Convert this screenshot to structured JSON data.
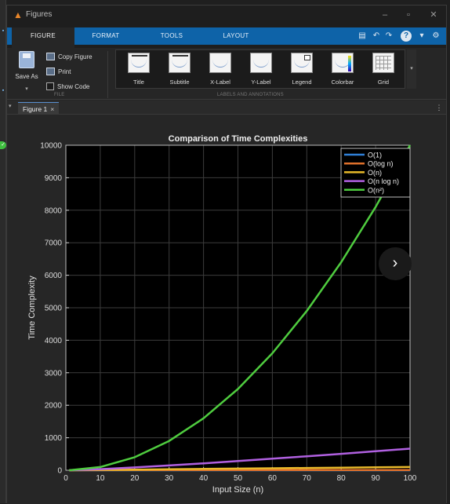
{
  "window": {
    "title": "Figures"
  },
  "ribbon_tabs": [
    {
      "label": "FIGURE",
      "active": true
    },
    {
      "label": "FORMAT",
      "active": false
    },
    {
      "label": "TOOLS",
      "active": false
    },
    {
      "label": "LAYOUT",
      "active": false
    }
  ],
  "file_section": {
    "label": "FILE",
    "save_as": "Save As",
    "copy_figure": "Copy Figure",
    "print": "Print",
    "show_code": "Show Code"
  },
  "labels_section": {
    "label": "LABELS AND ANNOTATIONS",
    "items": [
      "Title",
      "Subtitle",
      "X-Label",
      "Y-Label",
      "Legend",
      "Colorbar",
      "Grid"
    ]
  },
  "doc_tab": {
    "label": "Figure 1",
    "close": "×"
  },
  "icons": {
    "app": "matlab-icon",
    "minimize": "minimize-icon",
    "maximize": "maximize-icon",
    "close": "close-icon",
    "next": "chevron-right-icon",
    "menu": "more-vertical-icon",
    "help": "help-icon"
  },
  "chart_data": {
    "type": "line",
    "title": "Comparison of Time Complexities",
    "xlabel": "Input Size (n)",
    "ylabel": "Time Complexity",
    "xlim": [
      0,
      100
    ],
    "ylim": [
      0,
      10000
    ],
    "xticks": [
      0,
      10,
      20,
      30,
      40,
      50,
      60,
      70,
      80,
      90,
      100
    ],
    "yticks": [
      0,
      1000,
      2000,
      3000,
      4000,
      5000,
      6000,
      7000,
      8000,
      9000,
      10000
    ],
    "grid": true,
    "legend_position": "top-right",
    "x": [
      1,
      10,
      20,
      30,
      40,
      50,
      60,
      70,
      80,
      90,
      100
    ],
    "series": [
      {
        "name": "O(1)",
        "color": "#2f7fd6",
        "values": [
          1,
          1,
          1,
          1,
          1,
          1,
          1,
          1,
          1,
          1,
          1
        ]
      },
      {
        "name": "O(log n)",
        "color": "#e0712c",
        "values": [
          0,
          3.3,
          4.3,
          4.9,
          5.3,
          5.6,
          5.9,
          6.1,
          6.3,
          6.5,
          6.6
        ]
      },
      {
        "name": "O(n)",
        "color": "#e8b92a",
        "values": [
          1,
          10,
          20,
          30,
          40,
          50,
          60,
          70,
          80,
          90,
          100
        ]
      },
      {
        "name": "O(n log n)",
        "color": "#b060e0",
        "values": [
          0,
          33,
          86,
          147,
          213,
          282,
          354,
          429,
          506,
          584,
          664
        ]
      },
      {
        "name": "O(n²)",
        "color": "#4fcc3f",
        "values": [
          1,
          100,
          400,
          900,
          1600,
          2500,
          3600,
          4900,
          6400,
          8100,
          10000
        ]
      }
    ]
  }
}
